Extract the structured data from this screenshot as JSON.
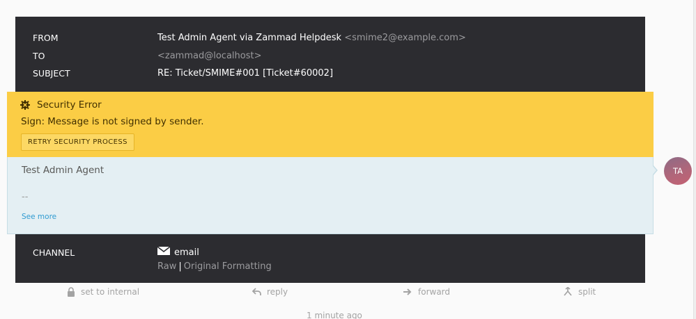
{
  "article": {
    "from_label": "FROM",
    "from_name": "Test Admin Agent via Zammad Helpdesk",
    "from_email": "<smime2@example.com>",
    "to_label": "TO",
    "to_value": "<zammad@localhost>",
    "subject_label": "SUBJECT",
    "subject_value": "RE: Ticket/SMIME#001 [Ticket#60002]",
    "channel_label": "CHANNEL",
    "channel_value": "email",
    "channel_icon": "envelope-icon",
    "raw_link": "Raw",
    "separator": "|",
    "original_link": "Original Formatting"
  },
  "security": {
    "title": "Security Error",
    "icon": "error-cog-icon",
    "message": "Sign: Message is not signed by sender.",
    "retry_label": "RETRY SECURITY PROCESS"
  },
  "body": {
    "text": "Test Admin Agent",
    "signature": "--",
    "see_more": "See more"
  },
  "avatar": {
    "initials": "TA"
  },
  "actions": {
    "internal": "set to internal",
    "reply": "reply",
    "forward": "forward",
    "split": "split"
  },
  "timestamp": "1 minute ago",
  "colors": {
    "meta_bg": "#2c2c30",
    "security_bg": "#fbcd45",
    "body_bg": "#e4eff3",
    "link": "#2f9bd1"
  }
}
